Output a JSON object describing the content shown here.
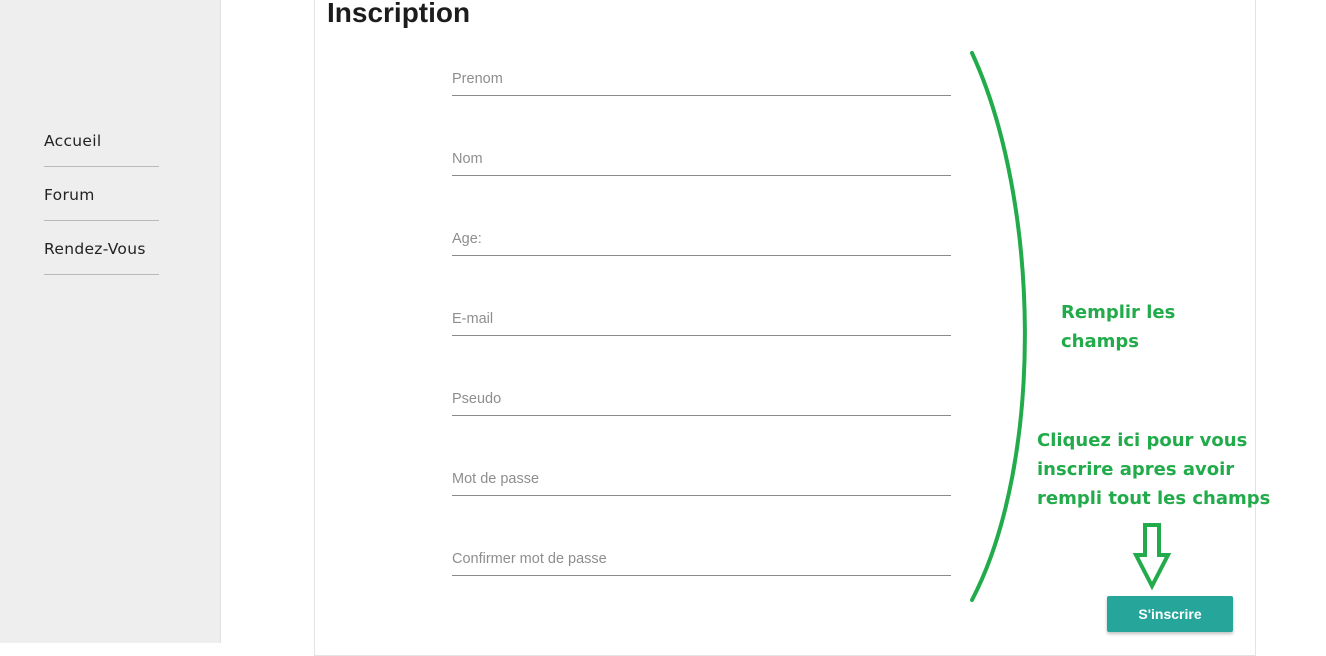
{
  "sidebar": {
    "items": [
      {
        "label": "Accueil"
      },
      {
        "label": "Forum"
      },
      {
        "label": "Rendez-Vous"
      }
    ]
  },
  "main": {
    "title": "Inscription",
    "fields": [
      {
        "placeholder": "Prenom",
        "value": ""
      },
      {
        "placeholder": "Nom",
        "value": ""
      },
      {
        "placeholder": "Age:",
        "value": ""
      },
      {
        "placeholder": "E-mail",
        "value": ""
      },
      {
        "placeholder": "Pseudo",
        "value": ""
      },
      {
        "placeholder": "Mot de passe",
        "value": ""
      },
      {
        "placeholder": "Confirmer mot de passe",
        "value": ""
      }
    ],
    "submit_label": "S'inscrire"
  },
  "annotations": {
    "fill_fields": "Remplir les champs",
    "click_here": "Cliquez ici pour vous inscrire apres avoir rempli tout les champs"
  },
  "colors": {
    "accent": "#26a69a",
    "annotation": "#22ab4a",
    "sidebar_bg": "#eeeeee"
  },
  "icons": {
    "brace": "curly-brace-annotation",
    "arrow": "down-arrow-annotation"
  }
}
